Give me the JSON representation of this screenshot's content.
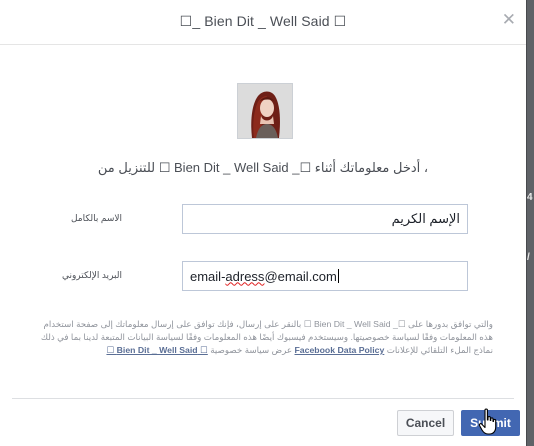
{
  "dialog": {
    "title": "☐_ Bien Dit _ Well Said ☐",
    "close_glyph": "✕",
    "intro": "، أدخل معلوماتك أثناء ☐_ Bien Dit _ Well Said ☐ للتنزيل من"
  },
  "form": {
    "name_label": "الاسم بالكامل",
    "name_value": "الإسم الكريم",
    "email_label": "البريد الإلكتروني",
    "email_user": "email-",
    "email_misspelled": "adress",
    "email_domain": "@email.com"
  },
  "policy": {
    "text_1": "والتي توافق بدورها على ☐_ Bien Dit _ Well Said ☐ بالنقر على إرسال، فإنك توافق على إرسال معلوماتك إلى صفحة استخدام هذه المعلومات وفقًا لسياسة خصوصيتها. وسيستخدم فيسبوك أيضًا هذه المعلومات وفقًا لسياسة البيانات المتبعة لدينا بما في ذلك نماذج الملء التلقائي للإعلانات",
    "link_facebook": "Facebook Data Policy",
    "text_2": "عرض سياسة خصوصية",
    "link_page": "☐ Bien Dit _ Well Said ☐"
  },
  "footer": {
    "cancel_label": "Cancel",
    "submit_label": "Submit"
  },
  "colors": {
    "accent": "#4267b2",
    "overlay": "#7b7d82"
  },
  "icons": {
    "close": "close-icon",
    "cursor": "hand-pointer-icon"
  }
}
